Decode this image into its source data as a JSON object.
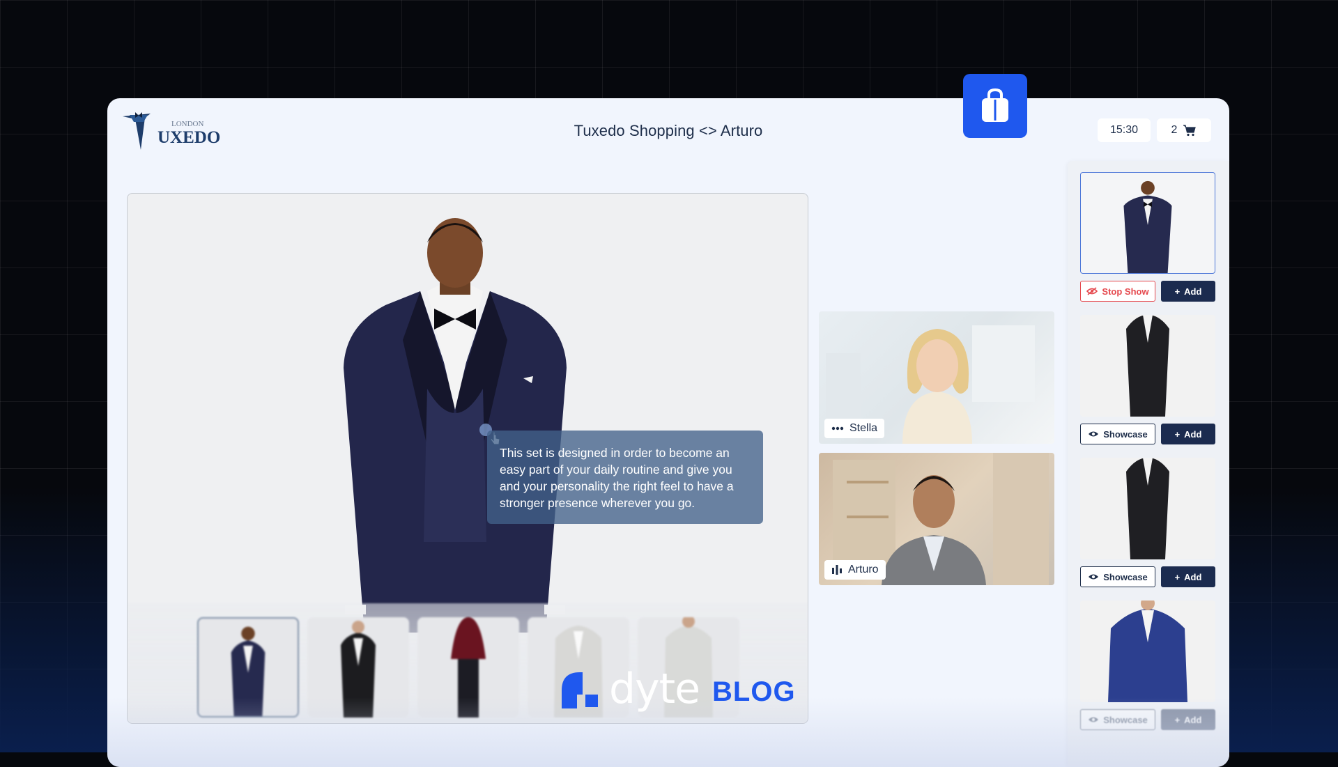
{
  "header": {
    "logo_text_top": "LONDON",
    "logo_text_main": "UXEDO",
    "title": "Tuxedo Shopping <> Arturo",
    "time": "15:30",
    "cart_count": "2"
  },
  "stage": {
    "tooltip_text": "This set is designed in order to become an easy part of your daily routine and give you and your personality the right feel to have a stronger presence wherever you go."
  },
  "participants": [
    {
      "name": "Stella",
      "icon": "more-dots-icon"
    },
    {
      "name": "Arturo",
      "icon": "audio-level-icon"
    }
  ],
  "products": [
    {
      "primary_label": "Stop Show",
      "primary_icon": "eye-off-icon",
      "add_label": "Add",
      "selected": true
    },
    {
      "primary_label": "Showcase",
      "primary_icon": "eye-icon",
      "add_label": "Add"
    },
    {
      "primary_label": "Showcase",
      "primary_icon": "eye-icon",
      "add_label": "Add"
    },
    {
      "primary_label": "Showcase",
      "primary_icon": "eye-icon",
      "add_label": "Add"
    }
  ],
  "brand": {
    "word": "dyte",
    "suffix": "BLOG"
  },
  "colors": {
    "accent": "#1f58ee",
    "navy": "#1b2b4f",
    "danger": "#e5484d"
  }
}
